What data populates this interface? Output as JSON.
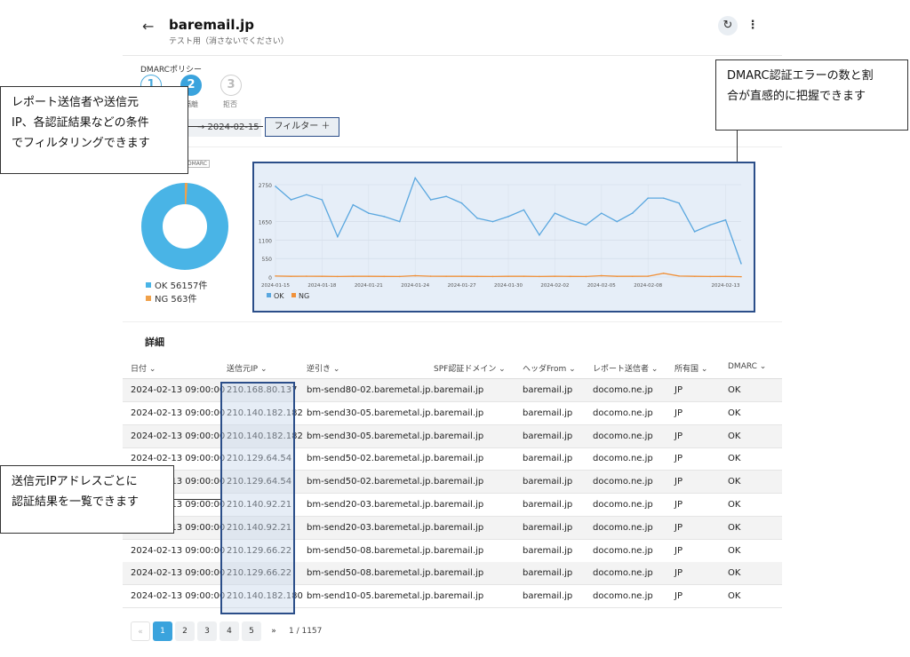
{
  "header": {
    "back_glyph": "←",
    "title": "baremail.jp",
    "subtitle": "テスト用（消さないでください）",
    "refresh_glyph": "↻",
    "more_glyph": "⋮"
  },
  "dmarc": {
    "label": "DMARCポリシー",
    "steps": [
      {
        "num": "1",
        "label": ""
      },
      {
        "num": "2",
        "label": "隔離"
      },
      {
        "num": "3",
        "label": "拒否"
      }
    ]
  },
  "filter": {
    "date": "→  2024-02-15",
    "button_label": "フィルター ＋"
  },
  "pie": {
    "tag": "DMARC",
    "legend": [
      {
        "label": "OK 56157件",
        "color": "#49b4e6"
      },
      {
        "label": "NG 563件",
        "color": "#f0a14a"
      }
    ]
  },
  "chart_data": {
    "type": "line",
    "x": [
      "2024-01-13",
      "2024-01-14",
      "2024-01-15",
      "2024-01-16",
      "2024-01-17",
      "2024-01-18",
      "2024-01-19",
      "2024-01-20",
      "2024-01-21",
      "2024-01-22",
      "2024-01-23",
      "2024-01-24",
      "2024-01-25",
      "2024-01-26",
      "2024-01-27",
      "2024-01-28",
      "2024-01-29",
      "2024-01-30",
      "2024-01-31",
      "2024-02-01",
      "2024-02-02",
      "2024-02-03",
      "2024-02-04",
      "2024-02-05",
      "2024-02-06",
      "2024-02-07",
      "2024-02-08",
      "2024-02-09",
      "2024-02-10",
      "2024-02-11",
      "2024-02-12",
      "2024-02-13",
      "2024-02-14"
    ],
    "xticks": [
      "2024-01-15",
      "2024-01-18",
      "2024-01-21",
      "2024-01-24",
      "2024-01-27",
      "2024-01-30",
      "2024-02-02",
      "2024-02-05",
      "2024-02-08",
      "2024-02-13"
    ],
    "yticks": [
      0,
      550,
      1100,
      1650,
      2750
    ],
    "ylim": [
      0,
      2750
    ],
    "series": [
      {
        "name": "OK",
        "color": "#5aa7df",
        "values": [
          2700,
          2300,
          2450,
          2300,
          1200,
          2150,
          1900,
          1800,
          1650,
          2950,
          2300,
          2400,
          2200,
          1750,
          1650,
          1800,
          2000,
          1250,
          1900,
          1700,
          1550,
          1900,
          1650,
          1900,
          2350,
          2350,
          2200,
          1350,
          1550,
          1700,
          400
        ]
      },
      {
        "name": "NG",
        "color": "#f0913a",
        "values": [
          30,
          20,
          25,
          20,
          15,
          20,
          20,
          18,
          15,
          40,
          25,
          22,
          20,
          18,
          15,
          20,
          22,
          15,
          20,
          18,
          15,
          40,
          20,
          20,
          25,
          110,
          30,
          20,
          15,
          18,
          10
        ]
      }
    ],
    "legend": [
      "OK",
      "NG"
    ],
    "legend_position": "bottom-left",
    "grid": true
  },
  "table": {
    "section_title": "詳細",
    "headers": [
      "日付 ⌄",
      "送信元IP ⌄",
      "逆引き ⌄",
      "SPF認証ドメイン ⌄",
      "ヘッダFrom ⌄",
      "レポート送信者 ⌄",
      "所有国 ⌄",
      "DMARC ⌄"
    ],
    "rows": [
      [
        "2024-02-13 09:00:00",
        "210.168.80.137",
        "bm-send80-02.baremetal.jp.",
        "baremail.jp",
        "baremail.jp",
        "docomo.ne.jp",
        "JP",
        "OK"
      ],
      [
        "2024-02-13 09:00:00",
        "210.140.182.182",
        "bm-send30-05.baremetal.jp.",
        "baremail.jp",
        "baremail.jp",
        "docomo.ne.jp",
        "JP",
        "OK"
      ],
      [
        "2024-02-13 09:00:00",
        "210.140.182.182",
        "bm-send30-05.baremetal.jp.",
        "baremail.jp",
        "baremail.jp",
        "docomo.ne.jp",
        "JP",
        "OK"
      ],
      [
        "2024-02-13 09:00:00",
        "210.129.64.54",
        "bm-send50-02.baremetal.jp.",
        "baremail.jp",
        "baremail.jp",
        "docomo.ne.jp",
        "JP",
        "OK"
      ],
      [
        "2024-02-13 09:00:00",
        "210.129.64.54",
        "bm-send50-02.baremetal.jp.",
        "baremail.jp",
        "baremail.jp",
        "docomo.ne.jp",
        "JP",
        "OK"
      ],
      [
        "2024-02-13 09:00:00",
        "210.140.92.21",
        "bm-send20-03.baremetal.jp.",
        "baremail.jp",
        "baremail.jp",
        "docomo.ne.jp",
        "JP",
        "OK"
      ],
      [
        "2024-02-13 09:00:00",
        "210.140.92.21",
        "bm-send20-03.baremetal.jp.",
        "baremail.jp",
        "baremail.jp",
        "docomo.ne.jp",
        "JP",
        "OK"
      ],
      [
        "2024-02-13 09:00:00",
        "210.129.66.22",
        "bm-send50-08.baremetal.jp.",
        "baremail.jp",
        "baremail.jp",
        "docomo.ne.jp",
        "JP",
        "OK"
      ],
      [
        "2024-02-13 09:00:00",
        "210.129.66.22",
        "bm-send50-08.baremetal.jp.",
        "baremail.jp",
        "baremail.jp",
        "docomo.ne.jp",
        "JP",
        "OK"
      ],
      [
        "2024-02-13 09:00:00",
        "210.140.182.180",
        "bm-send10-05.baremetal.jp.",
        "baremail.jp",
        "baremail.jp",
        "docomo.ne.jp",
        "JP",
        "OK"
      ]
    ]
  },
  "pagination": {
    "first": "«",
    "pages": [
      "1",
      "2",
      "3",
      "4",
      "5"
    ],
    "last": "»",
    "active": "1",
    "summary": "1 / 1157"
  },
  "callouts": {
    "filter_note": [
      "レポート送信者や送信元",
      "IP、各認証結果などの条件",
      "でフィルタリングできます"
    ],
    "chart_note": [
      "DMARC認証エラーの数と割",
      "合が直感的に把握できます"
    ],
    "ip_note": [
      "送信元IPアドレスごとに",
      "認証結果を一覧できます"
    ]
  }
}
